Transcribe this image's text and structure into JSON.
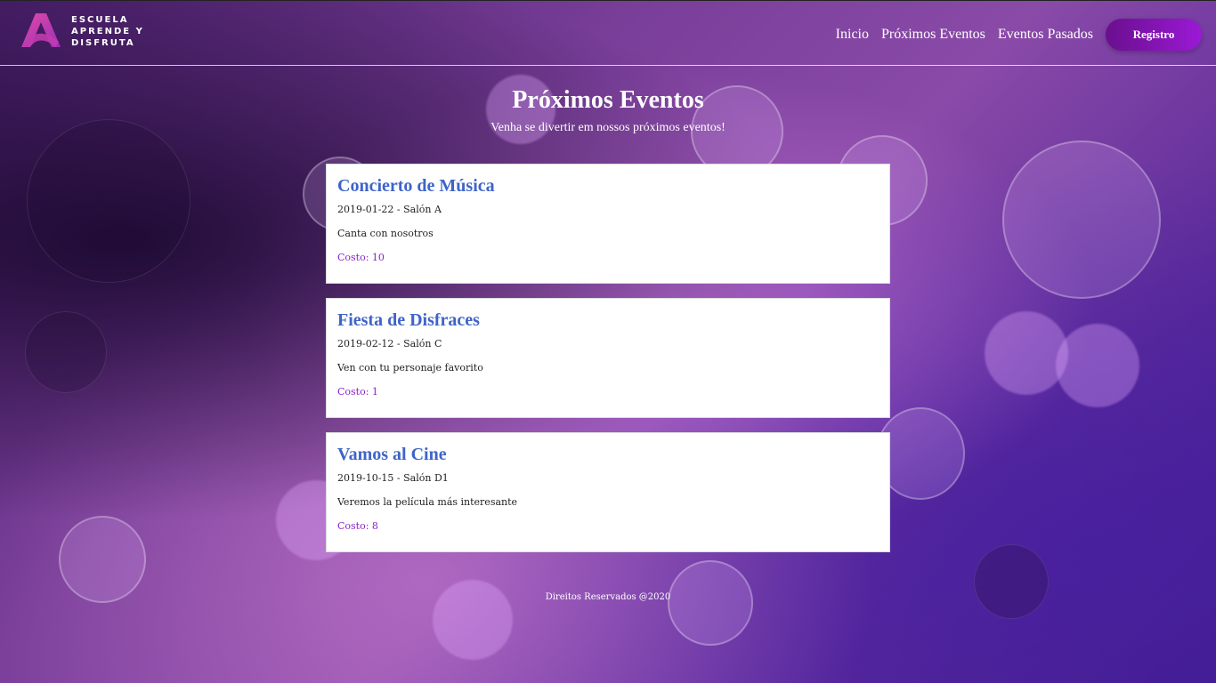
{
  "brand": {
    "logo_icon": "letter-a-logo-icon",
    "line1": "ESCUELA",
    "line2": "APRENDE Y",
    "line3": "DISFRUTA"
  },
  "nav": {
    "items": [
      {
        "label": "Inicio"
      },
      {
        "label": "Próximos Eventos"
      },
      {
        "label": "Eventos Pasados"
      }
    ],
    "register_label": "Registro"
  },
  "hero": {
    "title": "Próximos Eventos",
    "subtitle": "Venha se divertir em nossos próximos eventos!"
  },
  "events": [
    {
      "title": "Concierto de Música",
      "meta": "2019-01-22 - Salón A",
      "description": "Canta con nosotros",
      "cost": "Costo: 10"
    },
    {
      "title": "Fiesta de Disfraces",
      "meta": "2019-02-12 - Salón C",
      "description": "Ven con tu personaje favorito",
      "cost": "Costo: 1"
    },
    {
      "title": "Vamos al Cine",
      "meta": "2019-10-15 - Salón D1",
      "description": "Veremos la película más interesante",
      "cost": "Costo: 8"
    }
  ],
  "footer": {
    "text": "Direitos Reservados @2020"
  },
  "colors": {
    "accent": "#9b19d6",
    "event_title": "#3f64c8",
    "cost": "#8a22c9"
  }
}
